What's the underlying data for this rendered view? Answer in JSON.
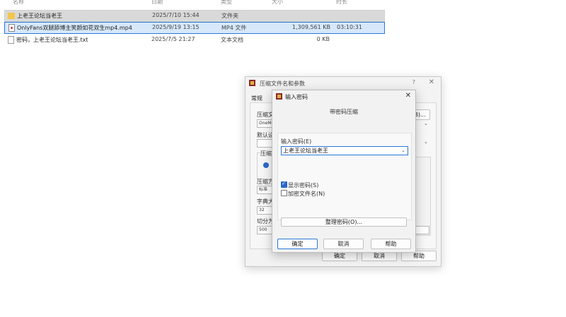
{
  "file_list": {
    "columns": [
      "名称",
      "日期",
      "类型",
      "大小",
      "时长"
    ],
    "rows": [
      {
        "name": "上老王论坛当老王",
        "date": "2025/7/10 15:44",
        "type": "文件夹",
        "size": "",
        "duration": "",
        "icon": "folder-icon"
      },
      {
        "name": "OnlyFans双腿舔博主笑颜如花双生mp4.mp4",
        "date": "2025/9/19 13:15",
        "type": "MP4 文件",
        "size": "1,309,561 KB",
        "duration": "03:10:31",
        "icon": "video-file-icon"
      },
      {
        "name": "密码，上老王论坛当老王.txt",
        "date": "2025/7/5 21:27",
        "type": "文本文档",
        "size": "0 KB",
        "duration": "",
        "icon": "text-file-icon"
      }
    ]
  },
  "archive_dialog": {
    "title": "压缩文件名和参数",
    "help": "?",
    "close": "✕",
    "tab": "常规",
    "archive_name_label": "压缩文",
    "archive_name_value": "OneMo",
    "browse_label": "B)...",
    "default_label": "默认设",
    "format_label": "压缩",
    "method_label": "压缩方",
    "method_value": "标准",
    "dict_label": "字典大",
    "dict_value": "32",
    "split_label": "切分为",
    "split_value": "500",
    "ok": "确定",
    "cancel": "取消",
    "help_btn": "帮助"
  },
  "password_dialog": {
    "title": "输入密码",
    "close": "✕",
    "heading": "带密码压缩",
    "password_label": "输入密码(E)",
    "password_value": "上老王论坛当老王",
    "show_password": "显示密码(S)",
    "show_password_checked": true,
    "encrypt_names": "加密文件名(N)",
    "encrypt_names_checked": false,
    "organize": "整理密码(O)...",
    "ok": "确定",
    "cancel": "取消",
    "help": "帮助"
  }
}
